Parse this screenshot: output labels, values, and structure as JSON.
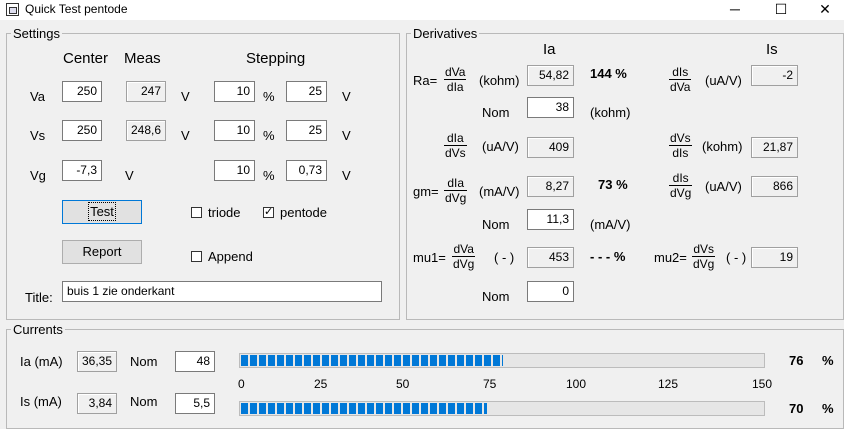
{
  "window": {
    "title": "Quick Test pentode",
    "min_glyph": "─",
    "max_glyph": "☐",
    "close_glyph": "✕"
  },
  "settings": {
    "legend": "Settings",
    "hdr_center": "Center",
    "hdr_meas": "Meas",
    "hdr_stepping": "Stepping",
    "va": {
      "label": "Va",
      "center": "250",
      "meas": "247",
      "unit": "V",
      "step_pct": "10",
      "pct": "%",
      "step_abs": "25",
      "unit2": "V"
    },
    "vs": {
      "label": "Vs",
      "center": "250",
      "meas": "248,6",
      "unit": "V",
      "step_pct": "10",
      "pct": "%",
      "step_abs": "25",
      "unit2": "V"
    },
    "vg": {
      "label": "Vg",
      "center": "-7,3",
      "unit": "V",
      "step_pct": "10",
      "pct": "%",
      "step_abs": "0,73",
      "unit2": "V"
    },
    "test_button": "Test",
    "report_button": "Report",
    "triode_label": "triode",
    "triode_checked": "",
    "pentode_label": "pentode",
    "pentode_checked": "✓",
    "append_label": "Append",
    "append_checked": "",
    "title_label": "Title:",
    "title_value": "buis 1 zie onderkant"
  },
  "derivatives": {
    "legend": "Derivatives",
    "col_ia": "Ia",
    "col_is": "Is",
    "ra_label": "Ra=",
    "ra_num": "dVa",
    "ra_den": "dIa",
    "ra_unit": "(kohm)",
    "ra_value": "54,82",
    "ra_pct": "144  %",
    "ra_nom_label": "Nom",
    "ra_nom": "38",
    "ra_nom_unit": "(kohm)",
    "is_a_num": "dIs",
    "is_a_den": "dVa",
    "is_a_unit": "(uA/V)",
    "is_a_value": "-2",
    "ia_b_num": "dIa",
    "ia_b_den": "dVs",
    "ia_b_unit": "(uA/V)",
    "ia_b_value": "409",
    "is_b_num": "dVs",
    "is_b_den": "dIs",
    "is_b_unit": "(kohm)",
    "is_b_value": "21,87",
    "gm_label": "gm=",
    "gm_num": "dIa",
    "gm_den": "dVg",
    "gm_unit": "(mA/V)",
    "gm_value": "8,27",
    "gm_pct": "73  %",
    "gm_nom_label": "Nom",
    "gm_nom": "11,3",
    "gm_nom_unit": "(mA/V)",
    "is_c_num": "dIs",
    "is_c_den": "dVg",
    "is_c_unit": "(uA/V)",
    "is_c_value": "866",
    "mu1_label": "mu1=",
    "mu1_num": "dVa",
    "mu1_den": "dVg",
    "mu1_unit": "( - )",
    "mu1_value": "453",
    "mu1_pct": "- - -  %",
    "mu1_nom_label": "Nom",
    "mu1_nom": "0",
    "mu2_label": "mu2=",
    "mu2_num": "dVs",
    "mu2_den": "dVg",
    "mu2_unit": "( - )",
    "mu2_value": "19"
  },
  "currents": {
    "legend": "Currents",
    "ia_label": "Ia (mA)",
    "ia_value": "36,35",
    "ia_nom_label": "Nom",
    "ia_nom": "48",
    "ia_pct": "76",
    "ia_pct_sign": "%",
    "ia_fill": 0.5,
    "is_label": "Is (mA)",
    "is_value": "3,84",
    "is_nom_label": "Nom",
    "is_nom": "5,5",
    "is_pct": "70",
    "is_pct_sign": "%",
    "is_fill": 0.47,
    "scale": [
      "0",
      "25",
      "50",
      "75",
      "100",
      "125",
      "150"
    ],
    "accent": "#0078d7"
  }
}
